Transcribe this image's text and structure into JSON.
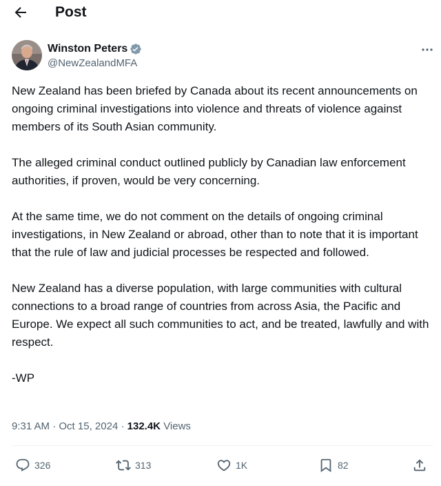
{
  "header": {
    "title": "Post",
    "back_icon": "arrow-left-icon"
  },
  "author": {
    "name": "Winston Peters",
    "handle": "@NewZealandMFA",
    "verified": true,
    "verified_color": "#829aab"
  },
  "post": {
    "paragraphs": [
      "New Zealand has been briefed by Canada about its recent announcements on ongoing criminal investigations into violence and threats of violence against members of its South Asian community.",
      "The alleged criminal conduct outlined publicly by Canadian law enforcement authorities, if proven, would be very concerning.",
      "At the same time, we do not comment on the details of ongoing criminal investigations, in New Zealand or abroad, other than to note that it is important that the rule of law and judicial processes be respected and followed.",
      "New Zealand has a diverse population, with large communities with cultural connections to a broad range of countries from across Asia, the Pacific and Europe. We expect all such communities to act, and be treated, lawfully and with respect.",
      "-WP"
    ]
  },
  "meta": {
    "time": "9:31 AM",
    "separator": "·",
    "date": "Oct 15, 2024",
    "views_count": "132.4K",
    "views_label": "Views"
  },
  "actions": {
    "replies": "326",
    "reposts": "313",
    "likes": "1K",
    "bookmarks": "82"
  },
  "colors": {
    "text": "#0f1419",
    "secondary": "#536471",
    "divider": "#eff3f4"
  }
}
